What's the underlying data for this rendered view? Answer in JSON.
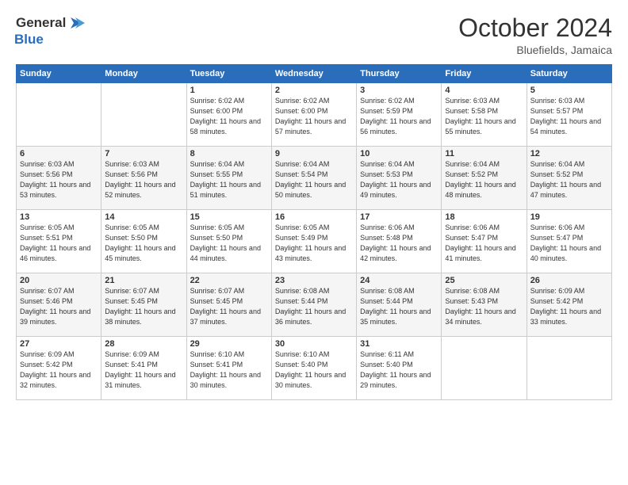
{
  "logo": {
    "general": "General",
    "blue": "Blue"
  },
  "title": "October 2024",
  "location": "Bluefields, Jamaica",
  "days_of_week": [
    "Sunday",
    "Monday",
    "Tuesday",
    "Wednesday",
    "Thursday",
    "Friday",
    "Saturday"
  ],
  "weeks": [
    [
      {
        "day": "",
        "info": ""
      },
      {
        "day": "",
        "info": ""
      },
      {
        "day": "1",
        "sunrise": "6:02 AM",
        "sunset": "6:00 PM",
        "daylight": "11 hours and 58 minutes."
      },
      {
        "day": "2",
        "sunrise": "6:02 AM",
        "sunset": "6:00 PM",
        "daylight": "11 hours and 57 minutes."
      },
      {
        "day": "3",
        "sunrise": "6:02 AM",
        "sunset": "5:59 PM",
        "daylight": "11 hours and 56 minutes."
      },
      {
        "day": "4",
        "sunrise": "6:03 AM",
        "sunset": "5:58 PM",
        "daylight": "11 hours and 55 minutes."
      },
      {
        "day": "5",
        "sunrise": "6:03 AM",
        "sunset": "5:57 PM",
        "daylight": "11 hours and 54 minutes."
      }
    ],
    [
      {
        "day": "6",
        "sunrise": "6:03 AM",
        "sunset": "5:56 PM",
        "daylight": "11 hours and 53 minutes."
      },
      {
        "day": "7",
        "sunrise": "6:03 AM",
        "sunset": "5:56 PM",
        "daylight": "11 hours and 52 minutes."
      },
      {
        "day": "8",
        "sunrise": "6:04 AM",
        "sunset": "5:55 PM",
        "daylight": "11 hours and 51 minutes."
      },
      {
        "day": "9",
        "sunrise": "6:04 AM",
        "sunset": "5:54 PM",
        "daylight": "11 hours and 50 minutes."
      },
      {
        "day": "10",
        "sunrise": "6:04 AM",
        "sunset": "5:53 PM",
        "daylight": "11 hours and 49 minutes."
      },
      {
        "day": "11",
        "sunrise": "6:04 AM",
        "sunset": "5:52 PM",
        "daylight": "11 hours and 48 minutes."
      },
      {
        "day": "12",
        "sunrise": "6:04 AM",
        "sunset": "5:52 PM",
        "daylight": "11 hours and 47 minutes."
      }
    ],
    [
      {
        "day": "13",
        "sunrise": "6:05 AM",
        "sunset": "5:51 PM",
        "daylight": "11 hours and 46 minutes."
      },
      {
        "day": "14",
        "sunrise": "6:05 AM",
        "sunset": "5:50 PM",
        "daylight": "11 hours and 45 minutes."
      },
      {
        "day": "15",
        "sunrise": "6:05 AM",
        "sunset": "5:50 PM",
        "daylight": "11 hours and 44 minutes."
      },
      {
        "day": "16",
        "sunrise": "6:05 AM",
        "sunset": "5:49 PM",
        "daylight": "11 hours and 43 minutes."
      },
      {
        "day": "17",
        "sunrise": "6:06 AM",
        "sunset": "5:48 PM",
        "daylight": "11 hours and 42 minutes."
      },
      {
        "day": "18",
        "sunrise": "6:06 AM",
        "sunset": "5:47 PM",
        "daylight": "11 hours and 41 minutes."
      },
      {
        "day": "19",
        "sunrise": "6:06 AM",
        "sunset": "5:47 PM",
        "daylight": "11 hours and 40 minutes."
      }
    ],
    [
      {
        "day": "20",
        "sunrise": "6:07 AM",
        "sunset": "5:46 PM",
        "daylight": "11 hours and 39 minutes."
      },
      {
        "day": "21",
        "sunrise": "6:07 AM",
        "sunset": "5:45 PM",
        "daylight": "11 hours and 38 minutes."
      },
      {
        "day": "22",
        "sunrise": "6:07 AM",
        "sunset": "5:45 PM",
        "daylight": "11 hours and 37 minutes."
      },
      {
        "day": "23",
        "sunrise": "6:08 AM",
        "sunset": "5:44 PM",
        "daylight": "11 hours and 36 minutes."
      },
      {
        "day": "24",
        "sunrise": "6:08 AM",
        "sunset": "5:44 PM",
        "daylight": "11 hours and 35 minutes."
      },
      {
        "day": "25",
        "sunrise": "6:08 AM",
        "sunset": "5:43 PM",
        "daylight": "11 hours and 34 minutes."
      },
      {
        "day": "26",
        "sunrise": "6:09 AM",
        "sunset": "5:42 PM",
        "daylight": "11 hours and 33 minutes."
      }
    ],
    [
      {
        "day": "27",
        "sunrise": "6:09 AM",
        "sunset": "5:42 PM",
        "daylight": "11 hours and 32 minutes."
      },
      {
        "day": "28",
        "sunrise": "6:09 AM",
        "sunset": "5:41 PM",
        "daylight": "11 hours and 31 minutes."
      },
      {
        "day": "29",
        "sunrise": "6:10 AM",
        "sunset": "5:41 PM",
        "daylight": "11 hours and 30 minutes."
      },
      {
        "day": "30",
        "sunrise": "6:10 AM",
        "sunset": "5:40 PM",
        "daylight": "11 hours and 30 minutes."
      },
      {
        "day": "31",
        "sunrise": "6:11 AM",
        "sunset": "5:40 PM",
        "daylight": "11 hours and 29 minutes."
      },
      {
        "day": "",
        "info": ""
      },
      {
        "day": "",
        "info": ""
      }
    ]
  ]
}
